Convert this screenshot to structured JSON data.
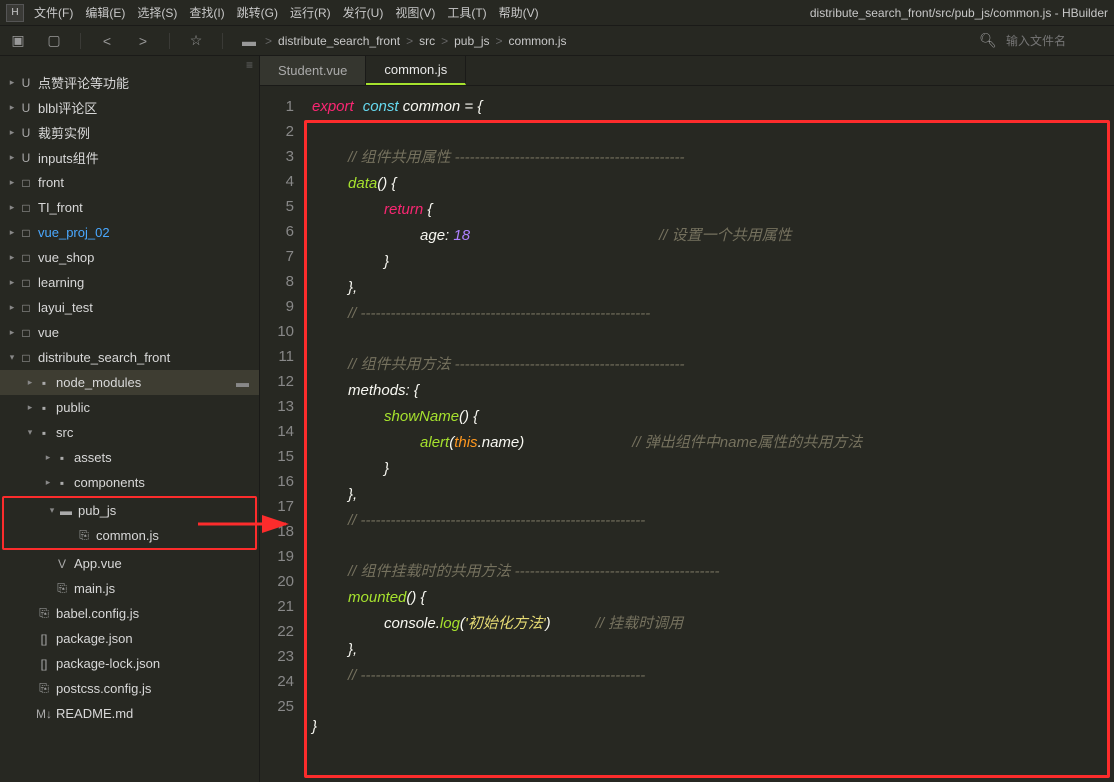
{
  "app": {
    "title": "distribute_search_front/src/pub_js/common.js - HBuilder",
    "logo": "H"
  },
  "menu": [
    "文件(F)",
    "编辑(E)",
    "选择(S)",
    "查找(I)",
    "跳转(G)",
    "运行(R)",
    "发行(U)",
    "视图(V)",
    "工具(T)",
    "帮助(V)"
  ],
  "breadcrumbs": [
    "distribute_search_front",
    "src",
    "pub_js",
    "common.js"
  ],
  "search_placeholder": "输入文件名",
  "tabs": [
    {
      "label": "Student.vue",
      "active": false
    },
    {
      "label": "common.js",
      "active": true
    }
  ],
  "tree": [
    {
      "indent": 0,
      "arrow": ">",
      "icon": "U",
      "label": "点赞评论等功能"
    },
    {
      "indent": 0,
      "arrow": ">",
      "icon": "U",
      "label": "blbl评论区"
    },
    {
      "indent": 0,
      "arrow": ">",
      "icon": "U",
      "label": "裁剪实例"
    },
    {
      "indent": 0,
      "arrow": ">",
      "icon": "U",
      "label": "inputs组件"
    },
    {
      "indent": 0,
      "arrow": ">",
      "icon": "□",
      "label": "front"
    },
    {
      "indent": 0,
      "arrow": ">",
      "icon": "□",
      "label": "TI_front"
    },
    {
      "indent": 0,
      "arrow": ">",
      "icon": "□",
      "label": "vue_proj_02",
      "blue": true
    },
    {
      "indent": 0,
      "arrow": ">",
      "icon": "□",
      "label": "vue_shop"
    },
    {
      "indent": 0,
      "arrow": ">",
      "icon": "□",
      "label": "learning"
    },
    {
      "indent": 0,
      "arrow": ">",
      "icon": "□",
      "label": "layui_test"
    },
    {
      "indent": 0,
      "arrow": ">",
      "icon": "□",
      "label": "vue"
    },
    {
      "indent": 0,
      "arrow": "v",
      "icon": "□",
      "label": "distribute_search_front"
    },
    {
      "indent": 1,
      "arrow": ">",
      "icon": "▪",
      "label": "node_modules",
      "sel": true,
      "dico": "▪"
    },
    {
      "indent": 1,
      "arrow": ">",
      "icon": "▪",
      "label": "public"
    },
    {
      "indent": 1,
      "arrow": "v",
      "icon": "▪",
      "label": "src"
    },
    {
      "indent": 2,
      "arrow": ">",
      "icon": "▪",
      "label": "assets"
    },
    {
      "indent": 2,
      "arrow": ">",
      "icon": "▪",
      "label": "components"
    },
    {
      "indent": 2,
      "arrow": "v",
      "icon": "▬",
      "label": "pub_js",
      "red": "start"
    },
    {
      "indent": 3,
      "arrow": "",
      "icon": "⎘",
      "label": "common.js",
      "red": "end"
    },
    {
      "indent": 2,
      "arrow": "",
      "icon": "V",
      "label": "App.vue"
    },
    {
      "indent": 2,
      "arrow": "",
      "icon": "⎘",
      "label": "main.js"
    },
    {
      "indent": 1,
      "arrow": "",
      "icon": "⎘",
      "label": "babel.config.js"
    },
    {
      "indent": 1,
      "arrow": "",
      "icon": "[]",
      "label": "package.json"
    },
    {
      "indent": 1,
      "arrow": "",
      "icon": "[]",
      "label": "package-lock.json"
    },
    {
      "indent": 1,
      "arrow": "",
      "icon": "⎘",
      "label": "postcss.config.js"
    },
    {
      "indent": 1,
      "arrow": "",
      "icon": "M↓",
      "label": "README.md"
    }
  ],
  "code": {
    "line_count": 25,
    "l1a": "export",
    "l1b": "const",
    "l1c": " common = {",
    "l3_com": "// 组件共用属性 ----------------------------------------------",
    "l4a": "data",
    "l4b": "() {",
    "l5a": "return",
    "l5b": " {",
    "l6a": "age: ",
    "l6b": "18",
    "l6_com": "// 设置一个共用属性",
    "l7": "}",
    "l8": "},",
    "l9_com": "// ----------------------------------------------------------",
    "l11_com": "// 组件共用方法 ----------------------------------------------",
    "l12a": "methods: {",
    "l13a": "showName",
    "l13b": "() {",
    "l14a": "alert",
    "l14b": "(",
    "l14c": "this",
    "l14d": ".name)",
    "l14_com": "// 弹出组件中name属性的共用方法",
    "l15": "}",
    "l16": "},",
    "l17_com": "// ---------------------------------------------------------",
    "l19_com": "// 组件挂载时的共用方法 -----------------------------------------",
    "l20a": "mounted",
    "l20b": "() {",
    "l21a": "console.",
    "l21b": "log",
    "l21c": "(",
    "l21d": "'初始化方法'",
    "l21e": ")",
    "l21_com": "// 挂载时调用",
    "l22": "},",
    "l23_com": "// ---------------------------------------------------------",
    "l25": "}"
  }
}
